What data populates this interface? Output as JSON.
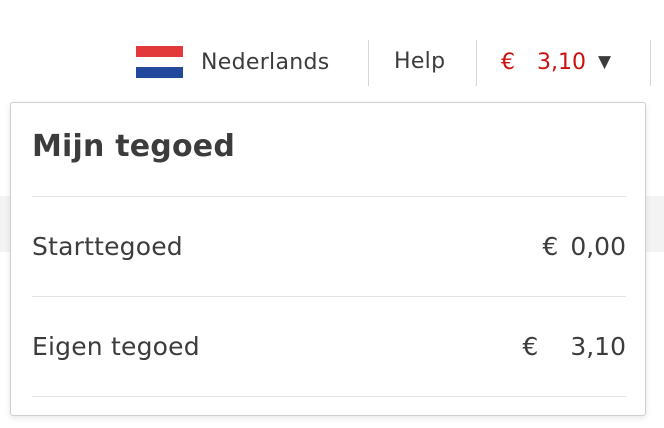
{
  "header": {
    "language": {
      "label": "Nederlands",
      "icon": "netherlands-flag-icon"
    },
    "help_label": "Help",
    "balance": {
      "currency": "€",
      "amount": "3,10",
      "caret_icon": "caret-down-icon"
    }
  },
  "colors": {
    "accent": "#cc1010",
    "text": "#3c3c3c",
    "divider": "#e2e2e2"
  },
  "dropdown": {
    "title": "Mijn tegoed",
    "rows": [
      {
        "label": "Starttegoed",
        "currency": "€",
        "amount": "0,00"
      },
      {
        "label": "Eigen tegoed",
        "currency": "€",
        "amount": "3,10"
      }
    ]
  }
}
